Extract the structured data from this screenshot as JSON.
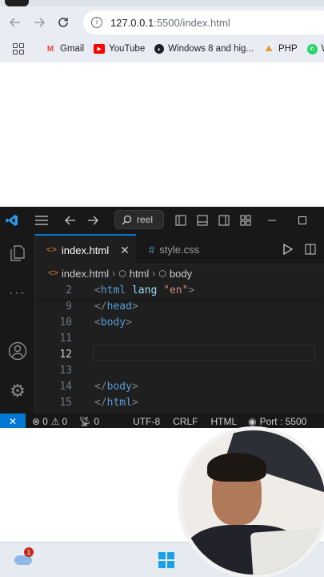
{
  "browser": {
    "url_host": "127.0.0.1",
    "url_rest": ":5500/index.html",
    "bookmarks": [
      {
        "label": "Gmail",
        "icon": "gmail-icon",
        "color": "#ea4335"
      },
      {
        "label": "YouTube",
        "icon": "youtube-icon",
        "color": "#ff0000"
      },
      {
        "label": "Windows 8 and hig...",
        "icon": "windows-site-icon",
        "color": "#202124"
      },
      {
        "label": "PHP",
        "icon": "php-icon",
        "color": "#e09a2c"
      },
      {
        "label": "Wh",
        "icon": "whatsapp-icon",
        "color": "#25d366"
      }
    ]
  },
  "vscode": {
    "command_center": "reel",
    "tabs": [
      {
        "label": "index.html",
        "icon": "html-file-icon",
        "icon_text": "<>",
        "active": true
      },
      {
        "label": "style.css",
        "icon": "css-file-icon",
        "icon_text": "#",
        "active": false
      }
    ],
    "breadcrumb": [
      "index.html",
      "html",
      "body"
    ],
    "lines": [
      {
        "num": "2",
        "tokens": [
          [
            "tag",
            "<"
          ],
          [
            "tname",
            "html"
          ],
          [
            "plain",
            " "
          ],
          [
            "attr",
            "lang"
          ],
          [
            "plain",
            "="
          ],
          [
            "str",
            "\"en\""
          ],
          [
            "tag",
            ">"
          ]
        ]
      },
      {
        "num": "9",
        "tokens": [
          [
            "tag",
            "</"
          ],
          [
            "tname",
            "head"
          ],
          [
            "tag",
            ">"
          ]
        ]
      },
      {
        "num": "10",
        "tokens": [
          [
            "tag",
            "<"
          ],
          [
            "tname",
            "body"
          ],
          [
            "tag",
            ">"
          ]
        ]
      },
      {
        "num": "11",
        "tokens": []
      },
      {
        "num": "12",
        "tokens": [],
        "current": true
      },
      {
        "num": "13",
        "tokens": []
      },
      {
        "num": "14",
        "tokens": [
          [
            "tag",
            "</"
          ],
          [
            "tname",
            "body"
          ],
          [
            "tag",
            ">"
          ]
        ]
      },
      {
        "num": "15",
        "tokens": [
          [
            "tag",
            "</"
          ],
          [
            "tname",
            "html"
          ],
          [
            "tag",
            ">"
          ]
        ]
      }
    ],
    "status": {
      "errors": "0",
      "warnings": "0",
      "ports": "0",
      "encoding": "UTF-8",
      "eol": "CRLF",
      "language": "HTML",
      "port_label": "Port : 5500"
    },
    "colors": {
      "accent": "#0078d4",
      "editor_bg": "#1f1f1f"
    }
  },
  "taskbar": {
    "weather_badge": "1"
  }
}
